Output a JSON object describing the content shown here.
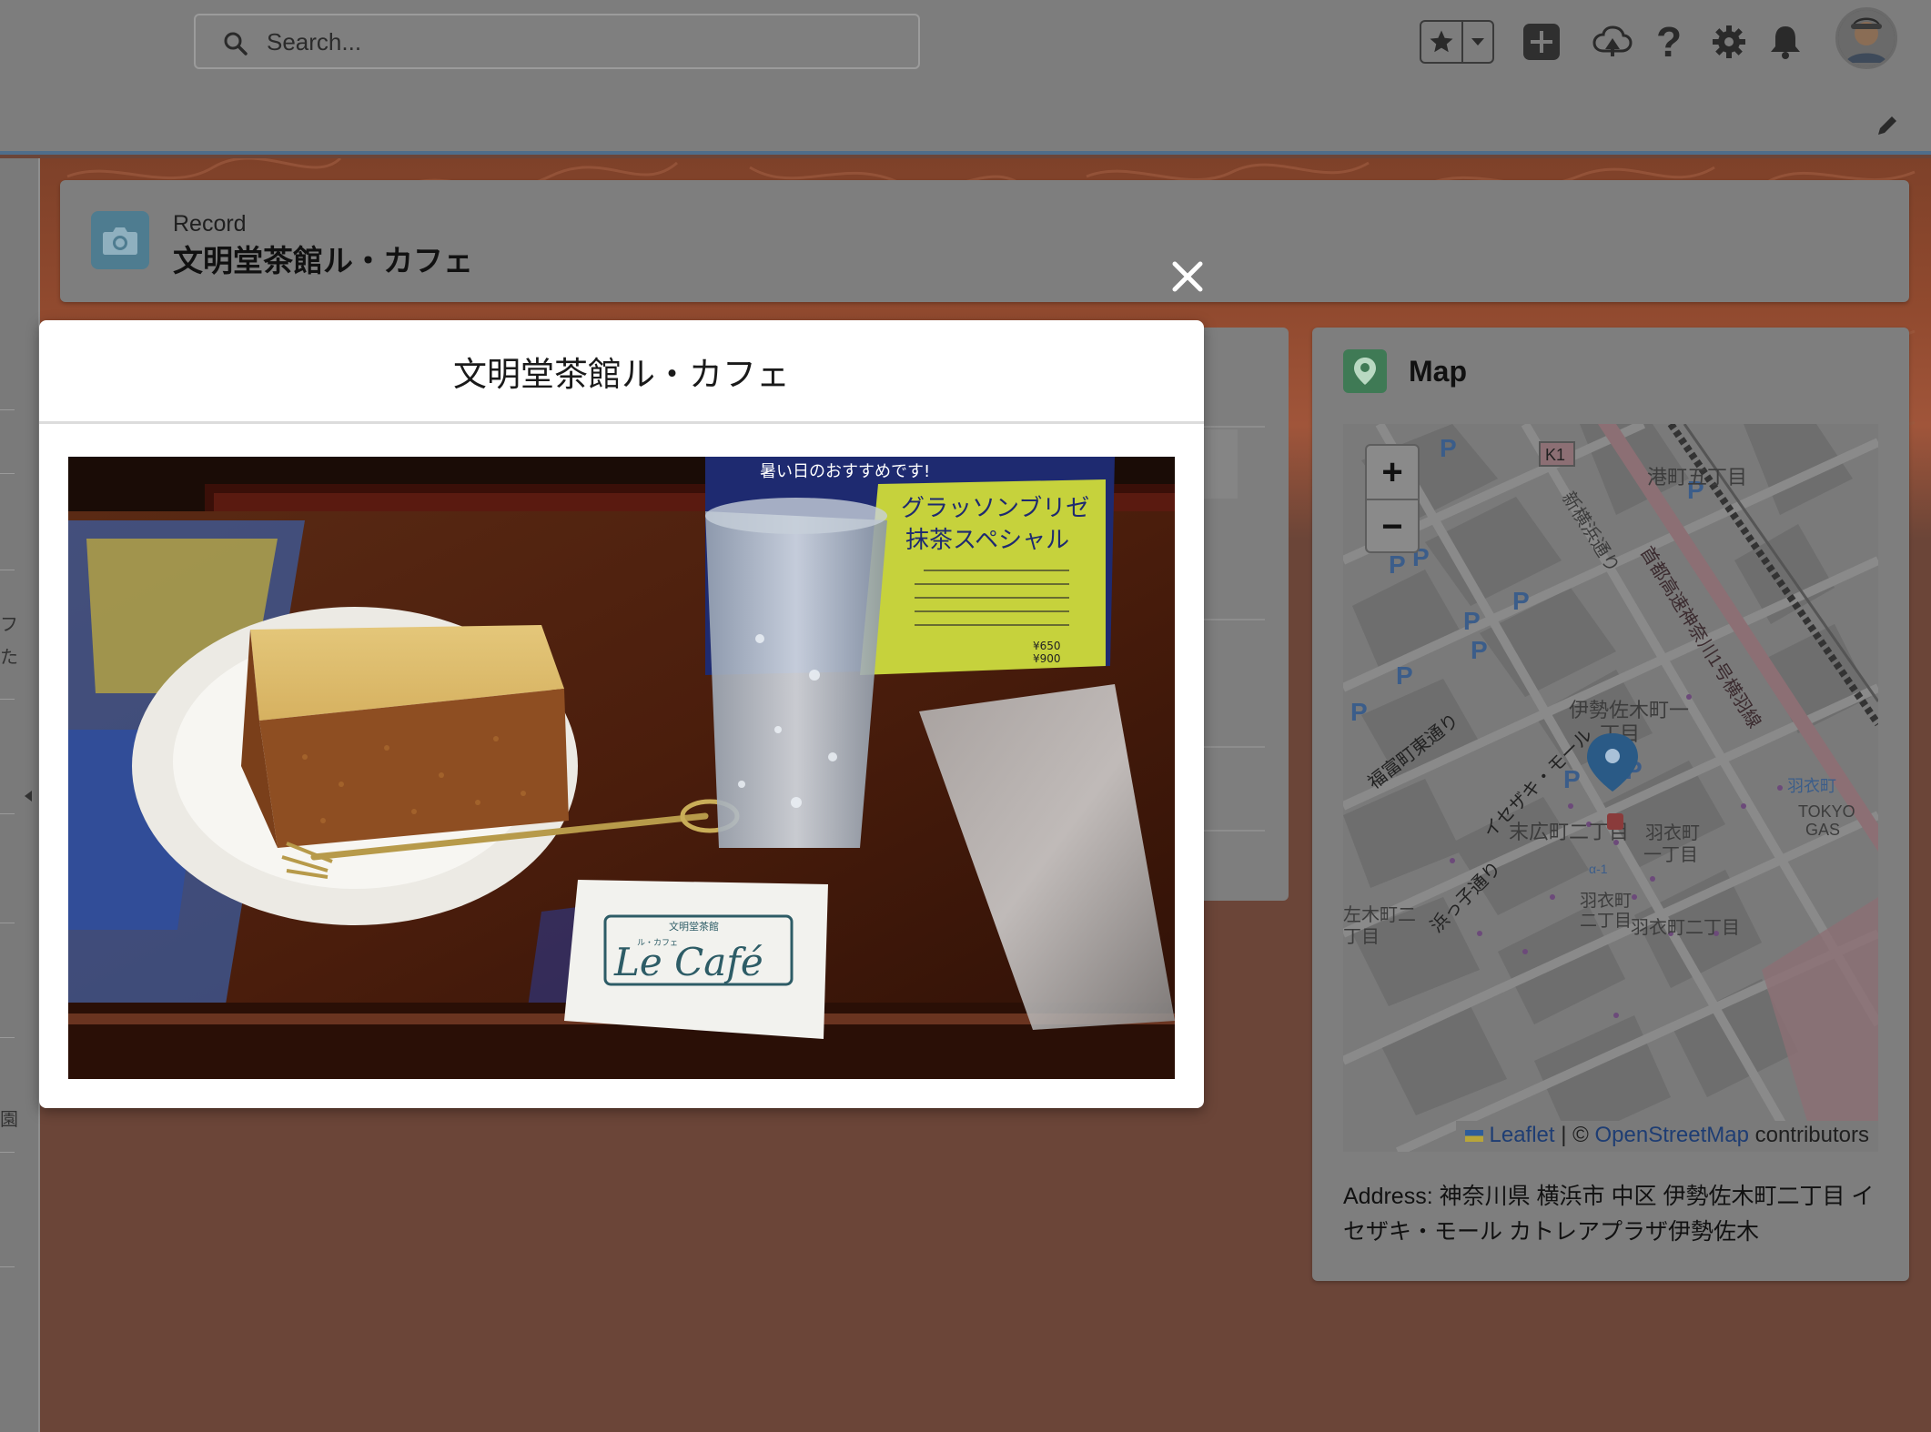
{
  "header": {
    "search_placeholder": "Search...",
    "icons": [
      "search-icon",
      "favorites-star-icon",
      "favorites-dropdown-icon",
      "global-actions-plus-icon",
      "trailhead-icon",
      "help-icon",
      "setup-gear-icon",
      "notifications-bell-icon",
      "user-avatar",
      "edit-nav-pencil-icon"
    ]
  },
  "record": {
    "label": "Record",
    "title": "文明堂茶館ル・カフェ",
    "icon": "camera-icon"
  },
  "left_strip_glyphs": [
    "フ",
    "た",
    "園"
  ],
  "modal": {
    "title": "文明堂茶館ル・カフェ",
    "close_icon": "close-icon",
    "photo": {
      "sign_header": "暑い日のおすすめです!",
      "sign_title_1": "グラッソンブリゼ",
      "sign_title_2": "抹茶スペシャル",
      "price_1": "¥650",
      "price_2": "¥900",
      "card_small": "文明堂茶館",
      "card_ruby": "ル・カフェ",
      "card_main": "Le Café"
    }
  },
  "map_card": {
    "title": "Map",
    "zoom_in": "+",
    "zoom_out": "−",
    "attribution": {
      "leaflet": "Leaflet",
      "separator": "| ©",
      "osm": "OpenStreetMap",
      "suffix": "contributors"
    },
    "address": "Address: 神奈川県 横浜市 中区 伊勢佐木町二丁目 イセザキ・モール カトレアプラザ伊勢佐木",
    "map_labels": {
      "highway_route": "K1",
      "street_1": "新横浜通り",
      "street_2": "首都高速神奈川1号横羽線",
      "area_1": "港町五丁目",
      "area_2_line1": "伊勢佐木町一",
      "area_2_line2": "丁目",
      "street_3": "福富町東通り",
      "street_4": "イセザキ・モール",
      "area_3": "末広町二丁目",
      "area_4_line1": "羽衣町",
      "area_4_line2": "一丁目",
      "station": "羽衣町",
      "company_1": "TOKYO",
      "company_2": "GAS",
      "street_5": "浜っ子通り",
      "area_5_line1": "羽衣町",
      "area_5_line2": "二丁目",
      "area_6": "羽衣町二丁目",
      "area_7_line1": "左木町二",
      "area_7_line2": "丁目",
      "parking": "P",
      "bus_stop_code": "α-1"
    }
  }
}
